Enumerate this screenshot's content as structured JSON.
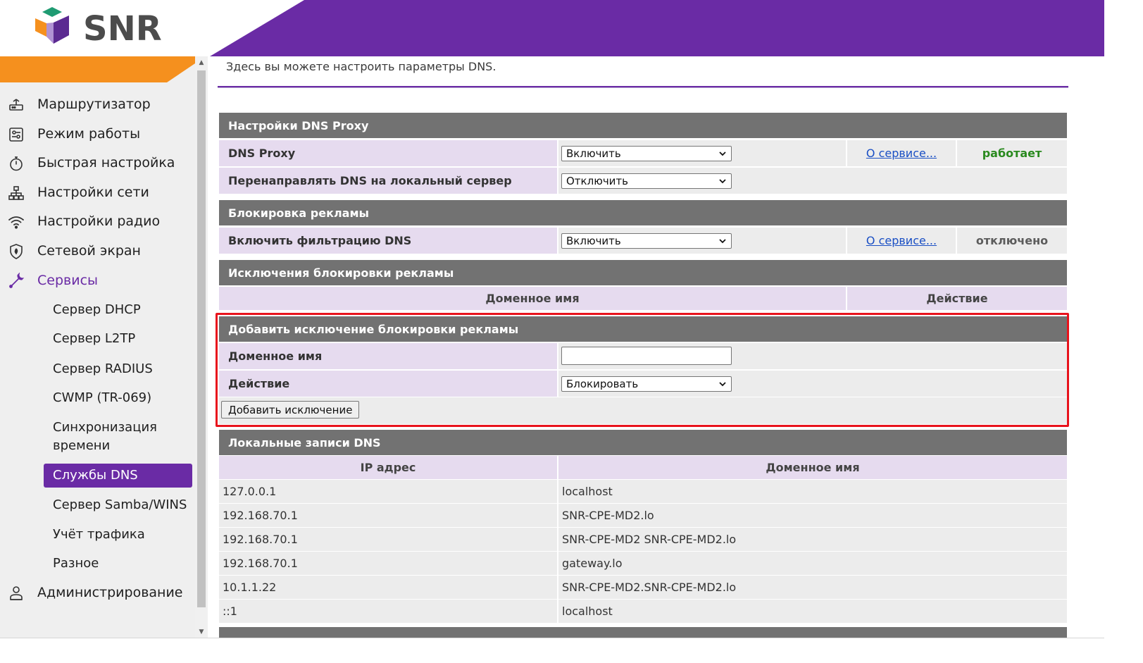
{
  "brand": {
    "name": "SNR",
    "colors": {
      "purple": "#6a2ba5",
      "orange": "#f5901e",
      "green": "#1f9b72",
      "highlight": "#e8131c"
    }
  },
  "sidebar": {
    "items": [
      {
        "label": "Маршрутизатор",
        "icon": "router-icon"
      },
      {
        "label": "Режим работы",
        "icon": "mode-settings-icon"
      },
      {
        "label": "Быстрая настройка",
        "icon": "stopwatch-icon"
      },
      {
        "label": "Настройки сети",
        "icon": "network-tree-icon"
      },
      {
        "label": "Настройки радио",
        "icon": "wifi-icon"
      },
      {
        "label": "Сетевой экран",
        "icon": "firewall-shield-icon"
      },
      {
        "label": "Сервисы",
        "icon": "wrench-icon",
        "active": true
      },
      {
        "label": "Администрирование",
        "icon": "admin-user-icon"
      }
    ],
    "services_sub": [
      {
        "label": "Сервер DHCP"
      },
      {
        "label": "Сервер L2TP"
      },
      {
        "label": "Сервер RADIUS"
      },
      {
        "label": "CWMP (TR-069)"
      },
      {
        "label": "Синхронизация времени"
      },
      {
        "label": "Службы DNS",
        "selected": true
      },
      {
        "label": "Сервер Samba/WINS"
      },
      {
        "label": "Учёт трафика"
      },
      {
        "label": "Разное"
      }
    ]
  },
  "main": {
    "intro": "Здесь вы можете настроить параметры DNS.",
    "dns_proxy_section": {
      "title": "Настройки DNS Proxy",
      "rows": [
        {
          "label": "DNS Proxy",
          "select_value": "Включить",
          "link": "О сервисе...",
          "status": "работает"
        },
        {
          "label": "Перенаправлять DNS на локальный сервер",
          "select_value": "Отключить"
        }
      ]
    },
    "adblock_section": {
      "title": "Блокировка рекламы",
      "rows": [
        {
          "label": "Включить фильтрацию DNS",
          "select_value": "Включить",
          "link": "О сервисе...",
          "status": "отключено"
        }
      ]
    },
    "exceptions_section": {
      "title": "Исключения блокировки рекламы",
      "columns": [
        "Доменное имя",
        "Действие"
      ]
    },
    "add_exception_section": {
      "title": "Добавить исключение блокировки рекламы",
      "domain_label": "Доменное имя",
      "domain_value": "",
      "action_label": "Действие",
      "action_value": "Блокировать",
      "button_label": "Добавить исключение"
    },
    "local_dns_section": {
      "title": "Локальные записи DNS",
      "columns": [
        "IP адрес",
        "Доменное имя"
      ],
      "rows": [
        {
          "ip": "127.0.0.1",
          "domain": "localhost"
        },
        {
          "ip": "192.168.70.1",
          "domain": "SNR-CPE-MD2.lo"
        },
        {
          "ip": "192.168.70.1",
          "domain": "SNR-CPE-MD2 SNR-CPE-MD2.lo"
        },
        {
          "ip": "192.168.70.1",
          "domain": "gateway.lo"
        },
        {
          "ip": "10.1.1.22",
          "domain": "SNR-CPE-MD2.SNR-CPE-MD2.lo"
        },
        {
          "ip": "::1",
          "domain": "localhost"
        }
      ]
    }
  }
}
